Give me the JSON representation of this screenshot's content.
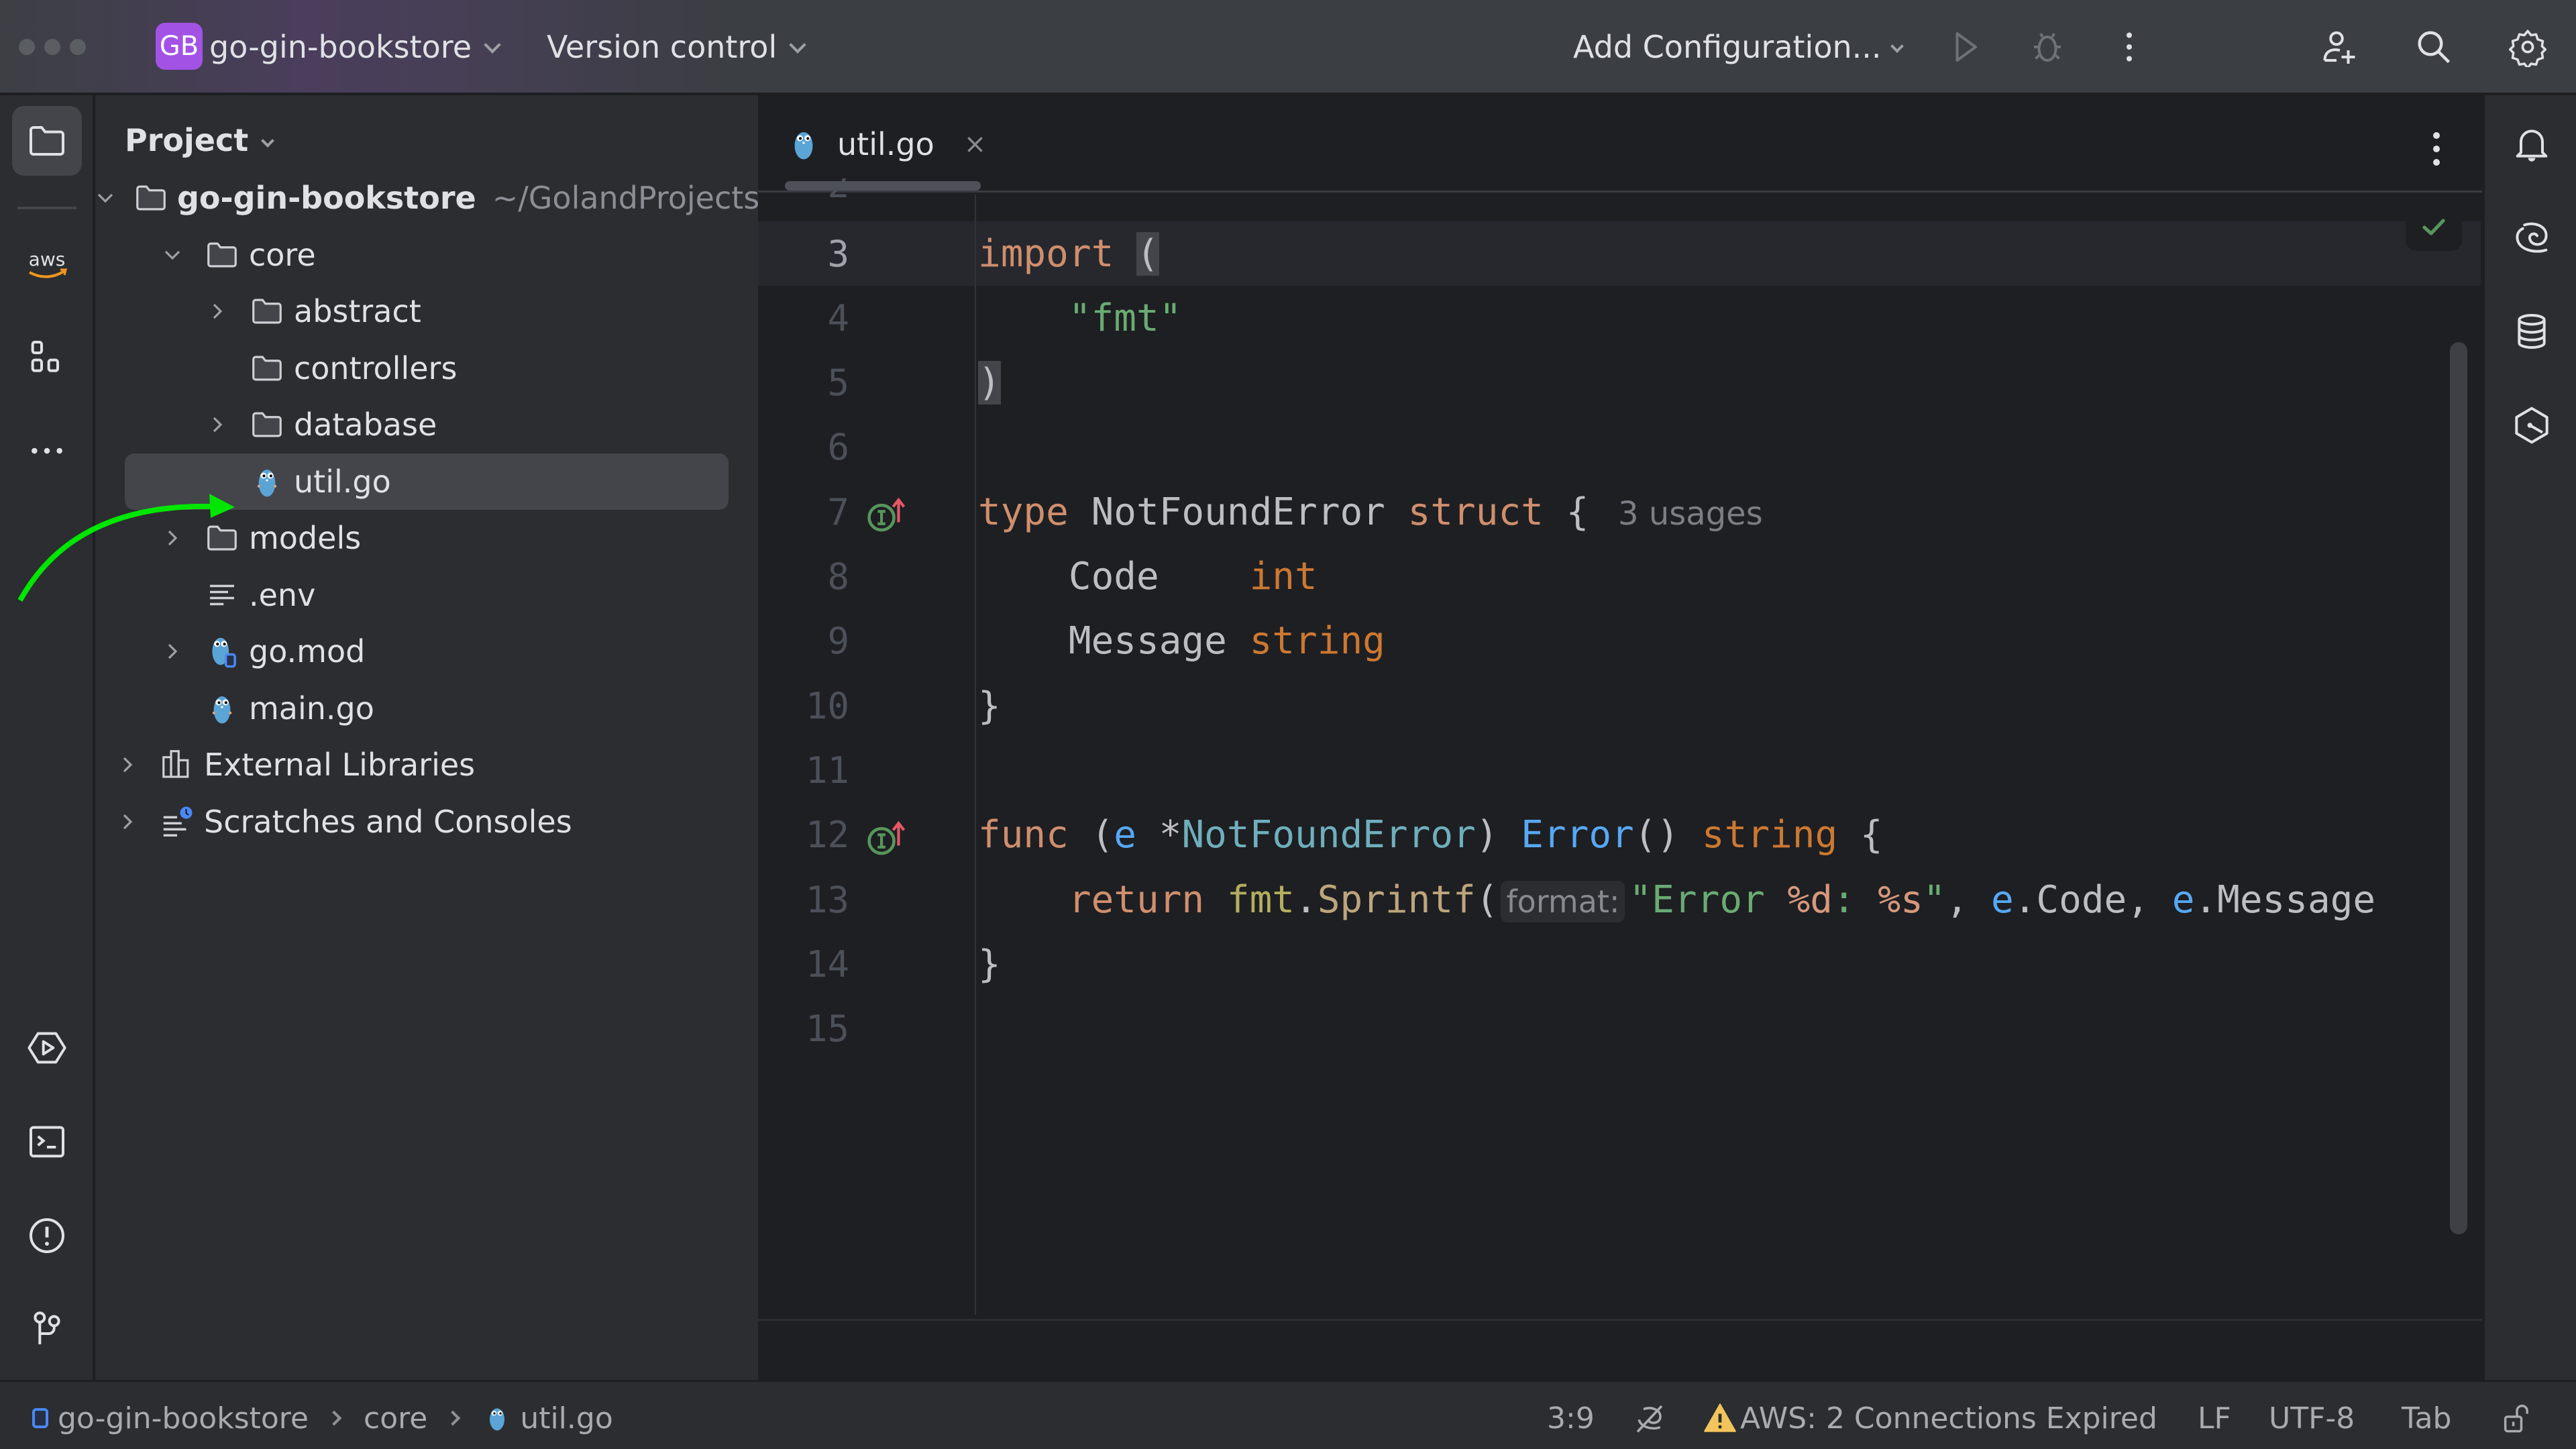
{
  "titlebar": {
    "project_badge": "GB",
    "project_name": "go-gin-bookstore",
    "vcs_label": "Version control",
    "run_config_label": "Add Configuration...",
    "icons": [
      "run-icon",
      "debug-icon",
      "more-vert-icon",
      "add-user-icon",
      "search-icon",
      "settings-gear-icon"
    ],
    "badge_color": "#a352e6"
  },
  "left_toolstrip": {
    "items": [
      "project-folder-icon",
      "aws-icon",
      "structure-icon",
      "more-horizontal-icon"
    ],
    "bottom_items": [
      "run-services-icon",
      "terminal-icon",
      "problems-icon",
      "git-icon"
    ],
    "aws_label": "aws"
  },
  "project_panel": {
    "title": "Project",
    "tree": [
      {
        "label": "go-gin-bookstore",
        "suffix": "~/GolandProjects/g",
        "type": "folder",
        "expanded": true,
        "depth": 0
      },
      {
        "label": "core",
        "type": "folder",
        "expanded": true,
        "depth": 1
      },
      {
        "label": "abstract",
        "type": "folder",
        "expanded": false,
        "depth": 2
      },
      {
        "label": "controllers",
        "type": "folder",
        "expanded": null,
        "depth": 2
      },
      {
        "label": "database",
        "type": "folder",
        "expanded": false,
        "depth": 2
      },
      {
        "label": "util.go",
        "type": "go-file",
        "selected": true,
        "depth": 2
      },
      {
        "label": "models",
        "type": "folder",
        "expanded": false,
        "depth": 1
      },
      {
        "label": ".env",
        "type": "text-file",
        "depth": 1
      },
      {
        "label": "go.mod",
        "type": "go-mod",
        "expanded": false,
        "depth": 1
      },
      {
        "label": "main.go",
        "type": "go-file",
        "depth": 1
      },
      {
        "label": "External Libraries",
        "type": "libraries",
        "expanded": false,
        "depth": 0
      },
      {
        "label": "Scratches and Consoles",
        "type": "scratches",
        "expanded": false,
        "depth": 0
      }
    ]
  },
  "editor": {
    "tab": {
      "label": "util.go",
      "close": "×"
    },
    "inspection_status": "ok",
    "lines": [
      {
        "n": "3",
        "tokens": [
          [
            "kw",
            "import"
          ],
          [
            "id",
            " "
          ],
          [
            "brace",
            "("
          ]
        ]
      },
      {
        "n": "4",
        "tokens": [
          [
            "id",
            "    "
          ],
          [
            "str",
            "\"fmt\""
          ]
        ]
      },
      {
        "n": "5",
        "tokens": [
          [
            "brace",
            ")"
          ]
        ]
      },
      {
        "n": "6",
        "tokens": []
      },
      {
        "n": "7",
        "gutter": "implements",
        "tokens": [
          [
            "kw",
            "type"
          ],
          [
            "id",
            " NotFoundError "
          ],
          [
            "kw",
            "struct"
          ],
          [
            "id",
            " { "
          ]
        ],
        "hint": "3 usages"
      },
      {
        "n": "8",
        "tokens": [
          [
            "id",
            "    Code    "
          ],
          [
            "bt",
            "int"
          ]
        ]
      },
      {
        "n": "9",
        "tokens": [
          [
            "id",
            "    Message "
          ],
          [
            "bt",
            "string"
          ]
        ]
      },
      {
        "n": "10",
        "tokens": [
          [
            "id",
            "}"
          ]
        ]
      },
      {
        "n": "11",
        "tokens": []
      },
      {
        "n": "12",
        "gutter": "implements",
        "tokens": [
          [
            "kw",
            "func"
          ],
          [
            "id",
            " ("
          ],
          [
            "recv",
            "e"
          ],
          [
            "id",
            " *"
          ],
          [
            "typ",
            "NotFoundError"
          ],
          [
            "id",
            ") "
          ],
          [
            "fn",
            "Error"
          ],
          [
            "id",
            "() "
          ],
          [
            "bt",
            "string"
          ],
          [
            "id",
            " {"
          ]
        ]
      },
      {
        "n": "13",
        "tokens": [
          [
            "id",
            "    "
          ],
          [
            "kw",
            "return"
          ],
          [
            "id",
            " "
          ],
          [
            "pkg",
            "fmt"
          ],
          [
            "id",
            "."
          ],
          [
            "call",
            "Sprintf"
          ],
          [
            "id",
            "("
          ],
          [
            "param",
            "format:"
          ],
          [
            "str",
            "\"Error "
          ],
          [
            "fmt",
            "%d"
          ],
          [
            "str",
            ": "
          ],
          [
            "fmt",
            "%s"
          ],
          [
            "str",
            "\""
          ],
          [
            "id",
            ", "
          ],
          [
            "recv",
            "e"
          ],
          [
            "id",
            ".Code, "
          ],
          [
            "recv",
            "e"
          ],
          [
            "id",
            ".Message"
          ]
        ]
      },
      {
        "n": "14",
        "tokens": [
          [
            "id",
            "}"
          ]
        ]
      },
      {
        "n": "15",
        "tokens": []
      }
    ],
    "current_line": "3"
  },
  "right_toolstrip": {
    "items": [
      "notifications-bell-icon",
      "ai-assistant-spiral-icon",
      "database-icon",
      "kubernetes-icon"
    ]
  },
  "statusbar": {
    "breadcrumb": [
      "go-gin-bookstore",
      "core",
      "util.go"
    ],
    "caret_position": "3:9",
    "aws_status": "AWS: 2 Connections Expired",
    "line_separator": "LF",
    "encoding": "UTF-8",
    "indent": "Tab",
    "warning_color": "#f2c55c"
  },
  "annotation": {
    "color": "#00e600",
    "target": "util.go"
  }
}
